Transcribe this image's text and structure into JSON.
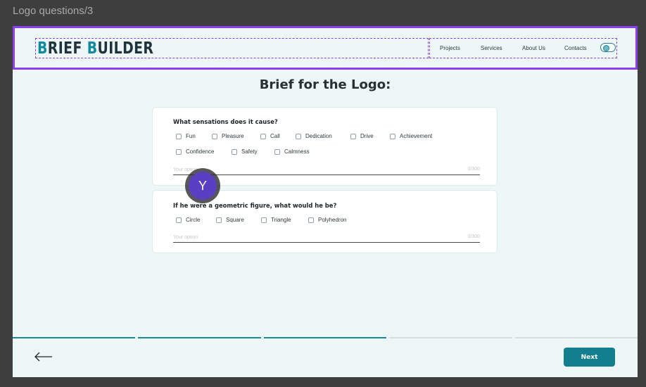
{
  "frame_label": "Logo questions/3",
  "brand": {
    "part1_first": "B",
    "part1_rest": "RIEF ",
    "part2_first": "B",
    "part2_rest": "UILDER"
  },
  "nav": {
    "items": [
      "Projects",
      "Services",
      "About Us",
      "Contacts"
    ],
    "theme_toggle_icon": "theme-toggle-icon"
  },
  "page_title": "Brief for the Logo:",
  "questions": [
    {
      "text": "What sensations does it cause?",
      "options": [
        "Fun",
        "Pleasure",
        "Call",
        "Dedication",
        "Drive",
        "Achievement",
        "Confidence",
        "Safety",
        "Calmness"
      ],
      "placeholder": "Your option",
      "counter": "0/300"
    },
    {
      "text": "If he were a geometric figure, what would he be?",
      "options": [
        "Circle",
        "Square",
        "Triangle",
        "Polyhedron"
      ],
      "placeholder": "Your option",
      "counter": "0/300"
    }
  ],
  "avatar_initial": "Y",
  "progress": {
    "segments": 5,
    "completed": 3
  },
  "footer": {
    "back_icon": "arrow-left-icon",
    "next_label": "Next"
  },
  "colors": {
    "accent": "#117f8e",
    "brand_dark": "#20323b",
    "brand_accent": "#0f8aa0",
    "selection": "#8a3ff0",
    "avatar": "#5a3fc4",
    "progress_active": "#1f8596",
    "progress_inactive": "#d7dfe0"
  }
}
